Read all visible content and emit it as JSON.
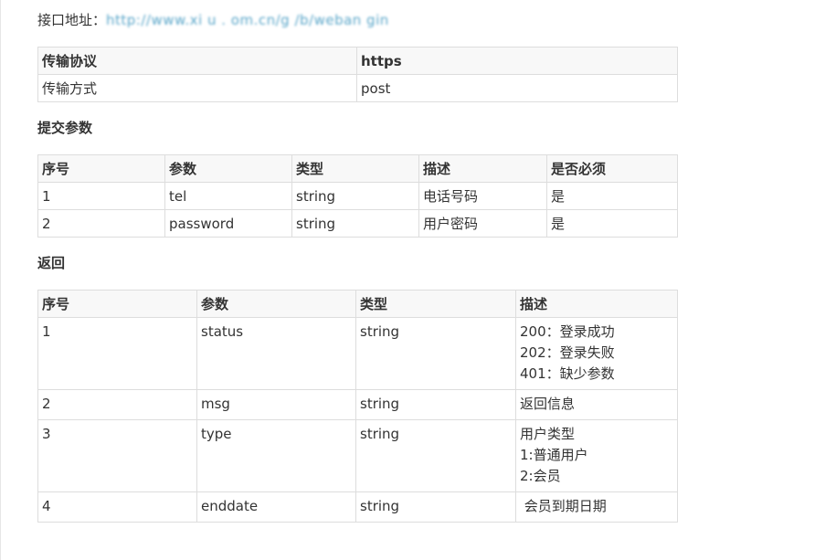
{
  "api": {
    "address_label": "接口地址：",
    "address_value": "http://www.xi   u  .   om.cn/g   /b/weban  gin"
  },
  "protocol_table": {
    "header": [
      "传输协议",
      "https"
    ],
    "rows": [
      [
        "传输方式",
        "post"
      ]
    ]
  },
  "submit_section_title": "提交参数",
  "params_table": {
    "headers": [
      "序号",
      "参数",
      "类型",
      "描述",
      "是否必须"
    ],
    "rows": [
      [
        "1",
        "tel",
        "string",
        "电话号码",
        "是"
      ],
      [
        "2",
        "password",
        "string",
        "用户密码",
        "是"
      ]
    ]
  },
  "return_section_title": "返回",
  "return_table": {
    "headers": [
      "序号",
      "参数",
      "类型",
      "描述"
    ],
    "rows": [
      {
        "no": "1",
        "param": "status",
        "type": "string",
        "desc": [
          "200：登录成功",
          "202：登录失败",
          "401：缺少参数"
        ]
      },
      {
        "no": "2",
        "param": "msg",
        "type": "string",
        "desc": [
          "返回信息"
        ]
      },
      {
        "no": "3",
        "param": "type",
        "type": "string",
        "desc": [
          "用户类型",
          "1:普通用户",
          "2:会员"
        ]
      },
      {
        "no": "4",
        "param": "enddate",
        "type": "string",
        "desc": [
          " 会员到期日期"
        ]
      }
    ]
  }
}
